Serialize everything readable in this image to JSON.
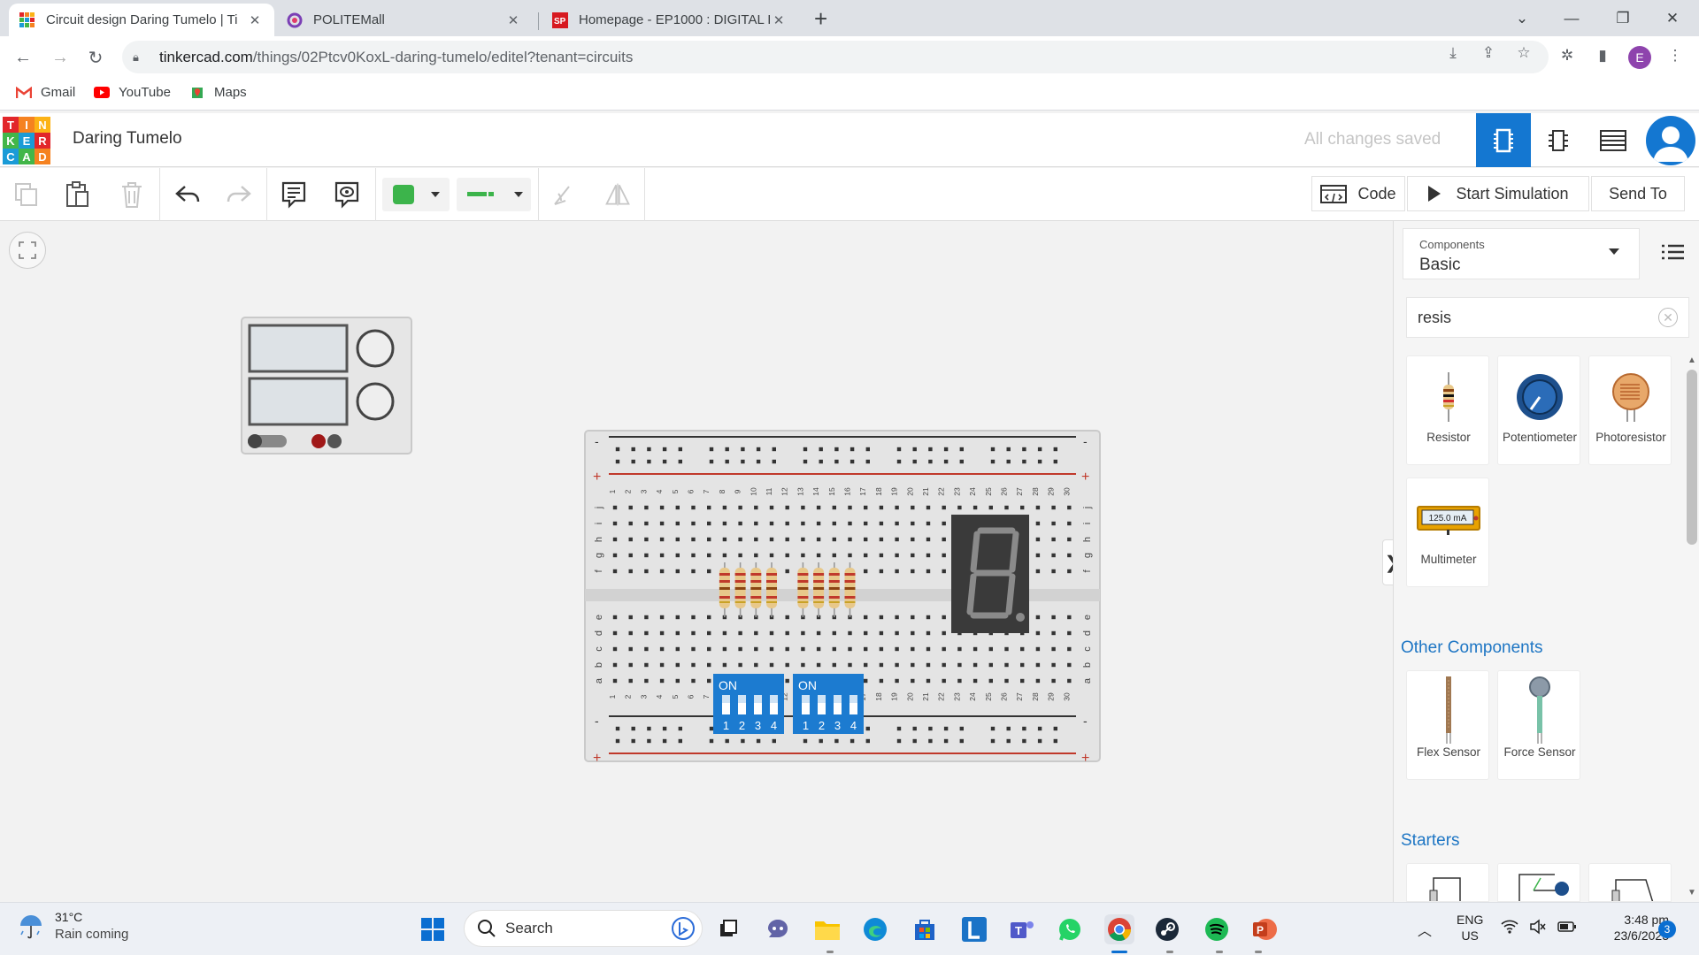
{
  "browser": {
    "tabs": [
      {
        "title": "Circuit design Daring Tumelo | Ti",
        "active": true
      },
      {
        "title": "POLITEMall",
        "active": false
      },
      {
        "title": "Homepage - EP1000 : DIGITAL FA",
        "active": false
      }
    ],
    "url_host": "tinkercad.com",
    "url_path": "/things/02Ptcv0KoxL-daring-tumelo/editel?tenant=circuits",
    "profile_initial": "E",
    "bookmarks": [
      {
        "label": "Gmail"
      },
      {
        "label": "YouTube"
      },
      {
        "label": "Maps"
      }
    ]
  },
  "app": {
    "logo_letters": [
      "T",
      "I",
      "N",
      "K",
      "E",
      "R",
      "C",
      "A",
      "D"
    ],
    "project_name": "Daring Tumelo",
    "save_status": "All changes saved",
    "toolbar": {
      "code_label": "Code",
      "start_sim_label": "Start Simulation",
      "send_to_label": "Send To",
      "color_swatch": "#3cb44b"
    },
    "breadboard": {
      "top_labels": [
        "j",
        "i",
        "h",
        "g",
        "f"
      ],
      "bottom_labels": [
        "e",
        "d",
        "c",
        "b",
        "a"
      ],
      "columns": [
        "1",
        "2",
        "3",
        "4",
        "5",
        "6",
        "7",
        "8",
        "9",
        "10",
        "11",
        "12",
        "13",
        "14",
        "15",
        "16",
        "17",
        "18",
        "19",
        "20",
        "21",
        "22",
        "23",
        "24",
        "25",
        "26",
        "27",
        "28",
        "29",
        "30"
      ],
      "rail_minus": "-",
      "rail_plus": "+"
    },
    "dip_switches": [
      {
        "label": "ON",
        "positions": [
          "1",
          "2",
          "3",
          "4"
        ]
      },
      {
        "label": "ON",
        "positions": [
          "1",
          "2",
          "3",
          "4"
        ]
      }
    ],
    "panel": {
      "components_label": "Components",
      "components_value": "Basic",
      "search_value": "resis",
      "results": [
        {
          "name": "Resistor"
        },
        {
          "name": "Potentiometer"
        },
        {
          "name": "Photoresistor"
        },
        {
          "name": "Multimeter",
          "display": "125.0 mA"
        }
      ],
      "other_heading": "Other Components",
      "other": [
        {
          "name": "Flex Sensor"
        },
        {
          "name": "Force Sensor"
        }
      ],
      "starters_heading": "Starters"
    }
  },
  "taskbar": {
    "weather_temp": "31°C",
    "weather_text": "Rain coming",
    "search_label": "Search",
    "lang1": "ENG",
    "lang2": "US",
    "time": "3:48 pm",
    "date": "23/6/2023",
    "notif_count": "3"
  },
  "colors": {
    "tinkercad_blue": "#1477d1",
    "link_blue": "#1e76c4",
    "dip_blue": "#1c7bd0",
    "resistor_body": "#e8c88a"
  }
}
